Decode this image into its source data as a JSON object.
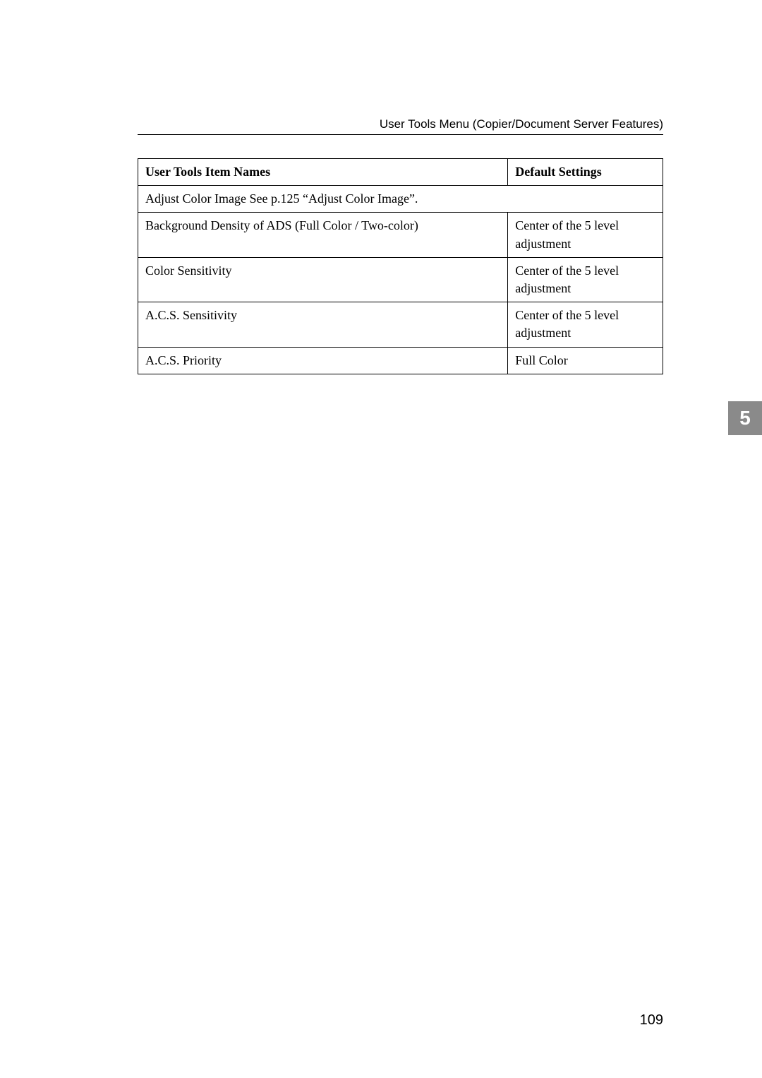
{
  "header": "User Tools Menu (Copier/Document Server Features)",
  "table": {
    "head": {
      "c1": "User Tools Item Names",
      "c2": "Default Settings"
    },
    "rows": [
      {
        "c1": "Adjust Color Image See p.125 “Adjust Color Image”.",
        "span": true
      },
      {
        "c1": "Background Density of ADS (Full Color / Two-color)",
        "c2": "Center of the 5 level adjustment"
      },
      {
        "c1": "Color Sensitivity",
        "c2": "Center of the 5 level adjustment"
      },
      {
        "c1": "A.C.S. Sensitivity",
        "c2": "Center of the 5 level adjustment"
      },
      {
        "c1": "A.C.S. Priority",
        "c2": "Full Color"
      }
    ]
  },
  "section_number": "5",
  "page_number": "109"
}
